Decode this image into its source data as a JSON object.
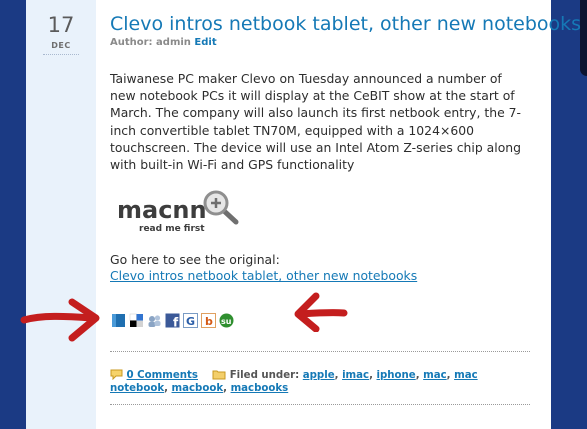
{
  "post": {
    "date_day": "17",
    "date_month": "DEC",
    "title": "Clevo intros netbook tablet, other new notebooks",
    "author_prefix": "Author: admin",
    "edit_label": "Edit",
    "body": "Taiwanese PC maker Clevo on Tuesday announced a number of new notebook PCs it will display at the CeBIT show at the start of March. The company will also launch its first netbook entry, the 7-inch convertible tablet TN70M, equipped with a 1024×600 touchscreen. The device will use an Intel Atom Z-series chip along with built-in Wi-Fi and GPS functionality",
    "logo": {
      "brand": "macnn",
      "tagline": "read me first"
    },
    "source_label": "Go here to see the original:",
    "source_link": "Clevo intros netbook tablet, other new notebooks"
  },
  "share_icons": [
    "blogger-icon",
    "delicious-icon",
    "digg-icon",
    "facebook-icon",
    "google-icon",
    "blinklist-icon",
    "stumbleupon-icon"
  ],
  "meta": {
    "comments_label": "0 Comments",
    "filed_under_label": "Filed under:",
    "tags": [
      "apple",
      "imac",
      "iphone",
      "mac",
      "mac notebook",
      "macbook",
      "macbooks"
    ]
  },
  "colors": {
    "link": "#1579b6",
    "arrow": "#c41e1e",
    "sidebar": "#1b3a84",
    "date_column": "#e9f2fb"
  }
}
